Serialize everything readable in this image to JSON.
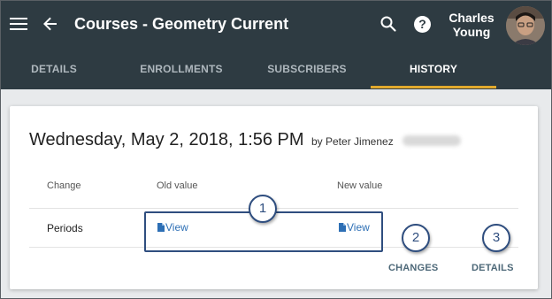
{
  "header": {
    "title": "Courses - Geometry Current",
    "user_name_line1": "Charles",
    "user_name_line2": "Young"
  },
  "tabs": [
    {
      "label": "DETAILS",
      "active": false
    },
    {
      "label": "ENROLLMENTS",
      "active": false
    },
    {
      "label": "SUBSCRIBERS",
      "active": false
    },
    {
      "label": "HISTORY",
      "active": true
    }
  ],
  "history": {
    "date": "Wednesday, May 2, 2018, 1:56 PM",
    "by": "by Peter Jimenez",
    "columns": {
      "change": "Change",
      "old_value": "Old value",
      "new_value": "New value"
    },
    "rows": [
      {
        "change": "Periods",
        "old_value_link": "View",
        "new_value_link": "View"
      }
    ],
    "actions": {
      "changes": "CHANGES",
      "details": "DETAILS"
    }
  },
  "callouts": [
    "1",
    "2",
    "3"
  ],
  "colors": {
    "app_bar": "#2e3b42",
    "tab_indicator": "#e2a92d",
    "link": "#2d6fb5",
    "callout_border": "#2f4e7f"
  },
  "icons": [
    "menu-icon",
    "back-arrow-icon",
    "search-icon",
    "help-icon",
    "document-icon"
  ]
}
